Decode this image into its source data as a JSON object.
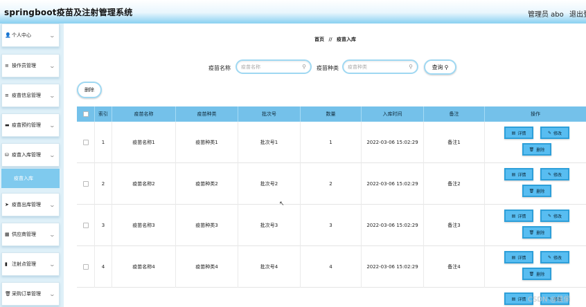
{
  "header": {
    "app_title": "springboot疫苗及注射管理系统",
    "user": "管理员 abo",
    "logout": "退出登"
  },
  "sidebar": {
    "items": [
      {
        "icon": "person-icon",
        "glyph": "👤",
        "label": "个人中心"
      },
      {
        "icon": "list-icon",
        "glyph": "≡",
        "label": "操作员管理"
      },
      {
        "icon": "list-icon",
        "glyph": "≡",
        "label": "疫苗信息管理"
      },
      {
        "icon": "box-icon",
        "glyph": "▬",
        "label": "疫苗预约管理"
      },
      {
        "icon": "database-icon",
        "glyph": "⛁",
        "label": "疫苗入库管理"
      },
      {
        "icon": "send-icon",
        "glyph": "➤",
        "label": "疫苗出库管理"
      },
      {
        "icon": "grid-icon",
        "glyph": "▦",
        "label": "供应商管理"
      },
      {
        "icon": "bookmark-icon",
        "glyph": "▮",
        "label": "注射点管理"
      },
      {
        "icon": "cart-icon",
        "glyph": "🗑",
        "label": "采购订单管理"
      }
    ],
    "active_sub": "疫苗入库"
  },
  "breadcrumb": {
    "home": "首页",
    "sep": "//",
    "current": "疫苗入库"
  },
  "search": {
    "name_label": "疫苗名称",
    "name_placeholder": "疫苗名称",
    "type_label": "疫苗种类",
    "type_placeholder": "疫苗种类",
    "query_label": "查询"
  },
  "toolbar": {
    "delete_label": "删除"
  },
  "table": {
    "headers": [
      "索引",
      "疫苗名称",
      "疫苗种类",
      "批次号",
      "数量",
      "入库时间",
      "备注",
      "操作"
    ],
    "rows": [
      {
        "index": "1",
        "name": "疫苗名称1",
        "type": "疫苗种类1",
        "batch": "批次号1",
        "qty": "1",
        "time": "2022-03-06 15:02:29",
        "note": "备注1"
      },
      {
        "index": "2",
        "name": "疫苗名称2",
        "type": "疫苗种类2",
        "batch": "批次号2",
        "qty": "2",
        "time": "2022-03-06 15:02:29",
        "note": "备注2"
      },
      {
        "index": "3",
        "name": "疫苗名称3",
        "type": "疫苗种类3",
        "batch": "批次号3",
        "qty": "3",
        "time": "2022-03-06 15:02:29",
        "note": "备注3"
      },
      {
        "index": "4",
        "name": "疫苗名称4",
        "type": "疫苗种类4",
        "batch": "批次号4",
        "qty": "4",
        "time": "2022-03-06 15:02:29",
        "note": "备注4"
      }
    ],
    "actions": {
      "detail": "详情",
      "edit": "修改",
      "delete": "删除"
    }
  },
  "watermark": "CSDN @佳偷",
  "colors": {
    "accent": "#74c1ea",
    "button": "#58bdf1",
    "sidebar_active": "#7fcaee"
  }
}
